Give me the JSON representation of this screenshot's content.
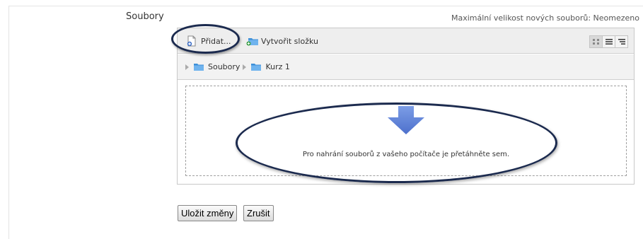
{
  "field": {
    "label": "Soubory",
    "max_size_text": "Maximální velikost nových souborů: Neomezeno"
  },
  "toolbar": {
    "add_label": "Přidat...",
    "add_icon": "file-add-icon",
    "create_folder_label": "Vytvořit složku",
    "create_folder_icon": "folder-add-icon",
    "views": [
      {
        "name": "icons-view",
        "icon": "grid-icon",
        "active": true
      },
      {
        "name": "list-view",
        "icon": "list-icon",
        "active": false
      },
      {
        "name": "tree-view",
        "icon": "tree-icon",
        "active": false
      }
    ]
  },
  "breadcrumb": {
    "items": [
      {
        "label": "Soubory",
        "icon": "folder-icon"
      },
      {
        "label": "Kurz 1",
        "icon": "folder-icon"
      }
    ]
  },
  "dropzone": {
    "icon": "down-arrow-icon",
    "text": "Pro nahrání souborů z vašeho počítače je přetáhněte sem."
  },
  "buttons": {
    "save": "Uložit změny",
    "cancel": "Zrušit"
  },
  "colors": {
    "annotation_ellipse": "#1b2a4e",
    "arrow_blue": "#5b7fd6",
    "folder_blue": "#3c8fd8"
  }
}
